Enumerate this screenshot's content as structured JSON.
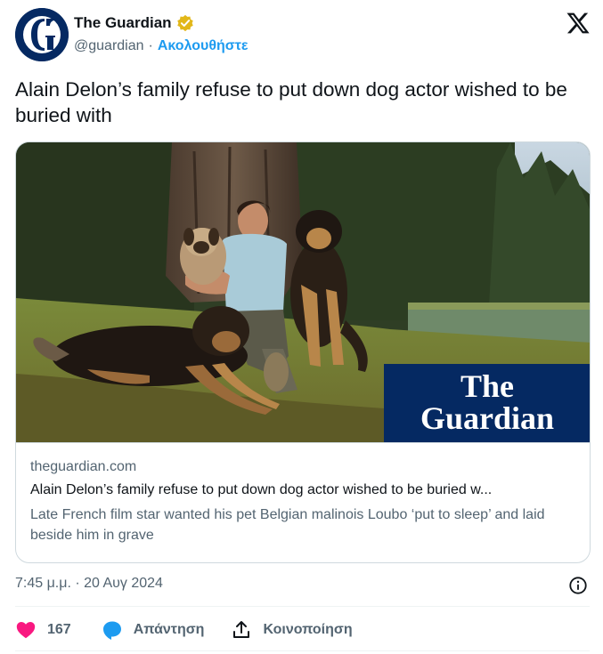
{
  "account": {
    "name": "The Guardian",
    "handle": "@guardian",
    "separator": "·",
    "follow_label": "Ακολουθήστε",
    "avatar_icon": "guardian-g-logo",
    "verified_icon": "gold-verified-badge",
    "platform_icon": "x-logo"
  },
  "tweet": {
    "text": "Alain Delon’s family refuse to put down dog actor wished to be buried with"
  },
  "card": {
    "image_icon": "photo-man-with-dogs-guardian-logo",
    "logo_line1": "The",
    "logo_line2": "Guardian",
    "domain": "theguardian.com",
    "title": "Alain Delon’s family refuse to put down dog actor wished to be buried w...",
    "description": "Late French film star wanted his pet Belgian malinois Loubo ‘put to sleep’ and laid beside him in grave"
  },
  "meta": {
    "timestamp": "7:45 μ.μ. · 20 Αυγ 2024",
    "info_icon": "info-icon"
  },
  "actions": {
    "like_count": "167",
    "reply_label": "Απάντηση",
    "share_label": "Κοινοποίηση"
  },
  "colors": {
    "brand_navy": "#052962",
    "link_blue": "#1d9bf0",
    "like_pink": "#f91880",
    "secondary_text": "#536471",
    "verified_gold": "#e2b719"
  }
}
